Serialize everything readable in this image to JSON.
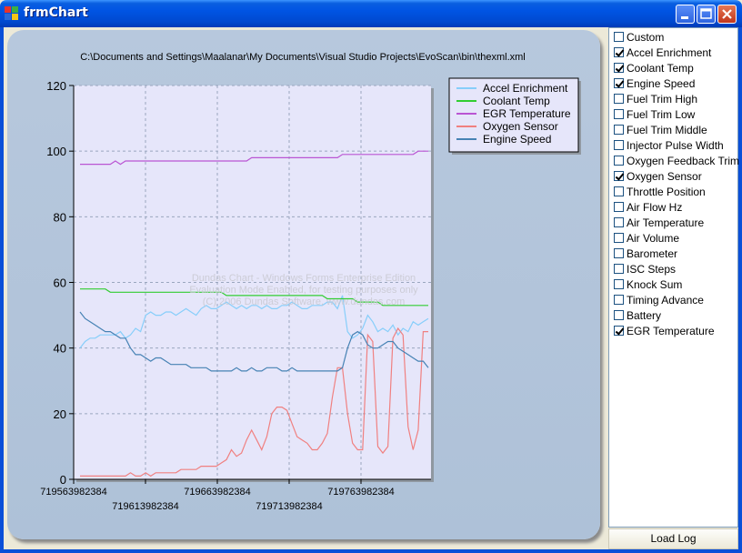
{
  "window": {
    "title": "frmChart"
  },
  "chart": {
    "file_path": "C:\\Documents and Settings\\Maalanar\\My Documents\\Visual Studio Projects\\EvoScan\\bin\\thexml.xml",
    "watermark": [
      "Dundas Chart - Windows Forms Enterprise Edition",
      "Evaluation Mode Enabled, for testing purposes only",
      "(C) 2006 Dundas Software, www.dundas.com"
    ]
  },
  "chart_data": {
    "type": "line",
    "ylim": [
      0,
      120
    ],
    "y_ticks": [
      "0",
      "20",
      "40",
      "60",
      "80",
      "100",
      "120"
    ],
    "x_tick_labels": [
      "719563982384",
      "719613982384",
      "719663982384",
      "719713982384",
      "719763982384"
    ],
    "grid": true,
    "legend_position": "top-right",
    "series": [
      {
        "name": "Accel Enrichment",
        "color": "#87cefa",
        "values": [
          40,
          42,
          43,
          43,
          44,
          44,
          44,
          44,
          45,
          43,
          44,
          46,
          45,
          50,
          51,
          50,
          50,
          51,
          51,
          50,
          51,
          52,
          51,
          50,
          52,
          53,
          52,
          52,
          53,
          54,
          53,
          52,
          53,
          52,
          53,
          53,
          52,
          53,
          52,
          52,
          53,
          53,
          54,
          53,
          52,
          52,
          53,
          53,
          53,
          54,
          54,
          52,
          56,
          45,
          43,
          44,
          46,
          50,
          48,
          45,
          46,
          45,
          47,
          44,
          46,
          45,
          48,
          47,
          48,
          49
        ]
      },
      {
        "name": "Coolant Temp",
        "color": "#32cd32",
        "values": [
          58,
          58,
          58,
          58,
          58,
          58,
          57,
          57,
          57,
          57,
          57,
          57,
          57,
          57,
          57,
          57,
          57,
          57,
          57,
          57,
          57,
          57,
          57,
          57,
          57,
          57,
          57,
          57,
          57,
          56,
          56,
          56,
          56,
          56,
          56,
          56,
          56,
          56,
          56,
          56,
          56,
          56,
          56,
          56,
          56,
          56,
          56,
          56,
          56,
          55,
          55,
          55,
          55,
          55,
          55,
          54,
          54,
          54,
          54,
          54,
          53,
          53,
          53,
          53,
          53,
          53,
          53,
          53,
          53,
          53
        ]
      },
      {
        "name": "EGR Temperature",
        "color": "#ba55d3",
        "values": [
          96,
          96,
          96,
          96,
          96,
          96,
          96,
          97,
          96,
          97,
          97,
          97,
          97,
          97,
          97,
          97,
          97,
          97,
          97,
          97,
          97,
          97,
          97,
          97,
          97,
          97,
          97,
          97,
          97,
          97,
          97,
          97,
          97,
          97,
          98,
          98,
          98,
          98,
          98,
          98,
          98,
          98,
          98,
          98,
          98,
          98,
          98,
          98,
          98,
          98,
          98,
          98,
          99,
          99,
          99,
          99,
          99,
          99,
          99,
          99,
          99,
          99,
          99,
          99,
          99,
          99,
          99,
          100,
          100,
          100
        ]
      },
      {
        "name": "Oxygen Sensor",
        "color": "#f08080",
        "values": [
          1,
          1,
          1,
          1,
          1,
          1,
          1,
          1,
          1,
          1,
          2,
          1,
          1,
          2,
          1,
          2,
          2,
          2,
          2,
          2,
          3,
          3,
          3,
          3,
          4,
          4,
          4,
          4,
          5,
          6,
          9,
          7,
          8,
          12,
          15,
          12,
          9,
          13,
          20,
          22,
          22,
          21,
          17,
          13,
          12,
          11,
          9,
          9,
          11,
          14,
          25,
          34,
          34,
          20,
          11,
          9,
          9,
          44,
          42,
          10,
          8,
          10,
          43,
          46,
          44,
          16,
          9,
          15,
          45,
          45
        ]
      },
      {
        "name": "Engine Speed",
        "color": "#4682b4",
        "values": [
          51,
          49,
          48,
          47,
          46,
          45,
          45,
          44,
          43,
          43,
          40,
          38,
          38,
          37,
          36,
          37,
          37,
          36,
          35,
          35,
          35,
          35,
          34,
          34,
          34,
          34,
          33,
          33,
          33,
          33,
          33,
          34,
          33,
          33,
          34,
          33,
          33,
          34,
          34,
          34,
          33,
          33,
          34,
          33,
          33,
          33,
          33,
          33,
          33,
          33,
          33,
          33,
          34,
          40,
          44,
          45,
          44,
          41,
          40,
          40,
          41,
          42,
          42,
          40,
          39,
          38,
          37,
          36,
          36,
          34
        ]
      }
    ]
  },
  "checklist": {
    "items": [
      {
        "label": "Custom",
        "checked": false
      },
      {
        "label": "Accel Enrichment",
        "checked": true
      },
      {
        "label": "Coolant Temp",
        "checked": true
      },
      {
        "label": "Engine Speed",
        "checked": true
      },
      {
        "label": "Fuel Trim High",
        "checked": false
      },
      {
        "label": "Fuel Trim Low",
        "checked": false
      },
      {
        "label": "Fuel Trim Middle",
        "checked": false
      },
      {
        "label": "Injector Pulse Width",
        "checked": false
      },
      {
        "label": "Oxygen Feedback Trim",
        "checked": false
      },
      {
        "label": "Oxygen Sensor",
        "checked": true
      },
      {
        "label": "Throttle Position",
        "checked": false
      },
      {
        "label": "Air Flow Hz",
        "checked": false
      },
      {
        "label": "Air Temperature",
        "checked": false
      },
      {
        "label": "Air Volume",
        "checked": false
      },
      {
        "label": "Barometer",
        "checked": false
      },
      {
        "label": "ISC Steps",
        "checked": false
      },
      {
        "label": "Knock Sum",
        "checked": false
      },
      {
        "label": "Timing Advance",
        "checked": false
      },
      {
        "label": "Battery",
        "checked": false
      },
      {
        "label": "EGR Temperature",
        "checked": true
      }
    ]
  },
  "buttons": {
    "load_log": "Load Log"
  }
}
